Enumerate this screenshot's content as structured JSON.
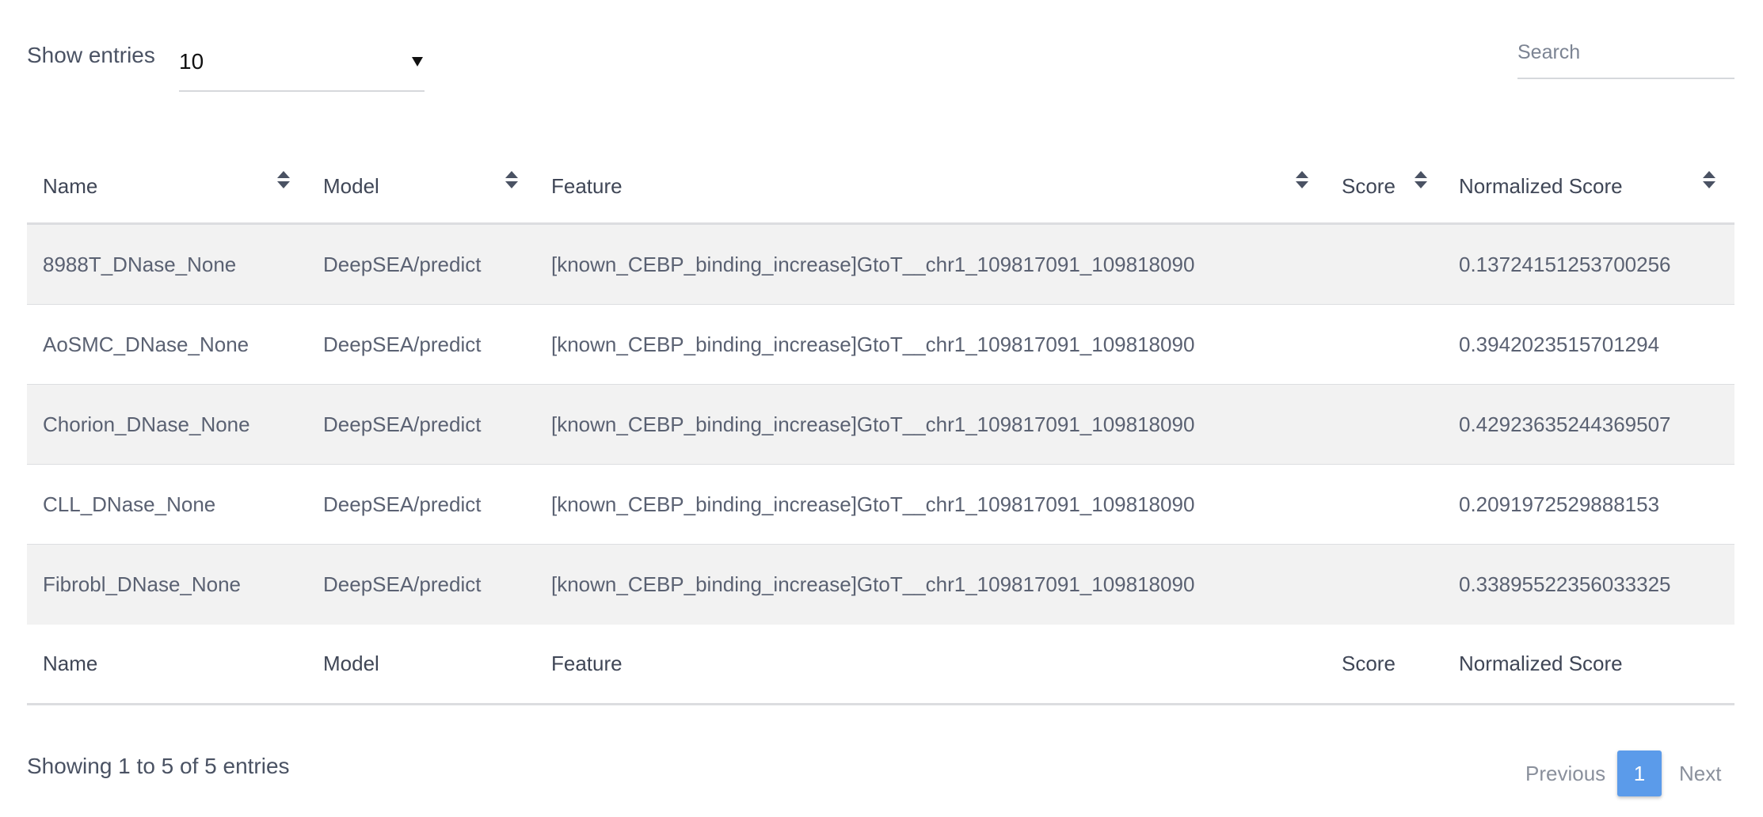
{
  "controls": {
    "length_label": "Show entries",
    "length_value": "10",
    "search_placeholder": "Search"
  },
  "table": {
    "columns": [
      "Name",
      "Model",
      "Feature",
      "Score",
      "Normalized Score"
    ],
    "rows": [
      {
        "name": "8988T_DNase_None",
        "model": "DeepSEA/predict",
        "feature": "[known_CEBP_binding_increase]GtoT__chr1_109817091_109818090",
        "score": "",
        "normalized_score": "0.13724151253700256"
      },
      {
        "name": "AoSMC_DNase_None",
        "model": "DeepSEA/predict",
        "feature": "[known_CEBP_binding_increase]GtoT__chr1_109817091_109818090",
        "score": "",
        "normalized_score": "0.3942023515701294"
      },
      {
        "name": "Chorion_DNase_None",
        "model": "DeepSEA/predict",
        "feature": "[known_CEBP_binding_increase]GtoT__chr1_109817091_109818090",
        "score": "",
        "normalized_score": "0.42923635244369507"
      },
      {
        "name": "CLL_DNase_None",
        "model": "DeepSEA/predict",
        "feature": "[known_CEBP_binding_increase]GtoT__chr1_109817091_109818090",
        "score": "",
        "normalized_score": "0.2091972529888153"
      },
      {
        "name": "Fibrobl_DNase_None",
        "model": "DeepSEA/predict",
        "feature": "[known_CEBP_binding_increase]GtoT__chr1_109817091_109818090",
        "score": "",
        "normalized_score": "0.33895522356033325"
      }
    ]
  },
  "footer": {
    "info": "Showing 1 to 5 of 5 entries",
    "previous": "Previous",
    "current_page": "1",
    "next": "Next"
  },
  "colors": {
    "accent": "#5b9bea",
    "stripe": "#f2f2f2"
  }
}
